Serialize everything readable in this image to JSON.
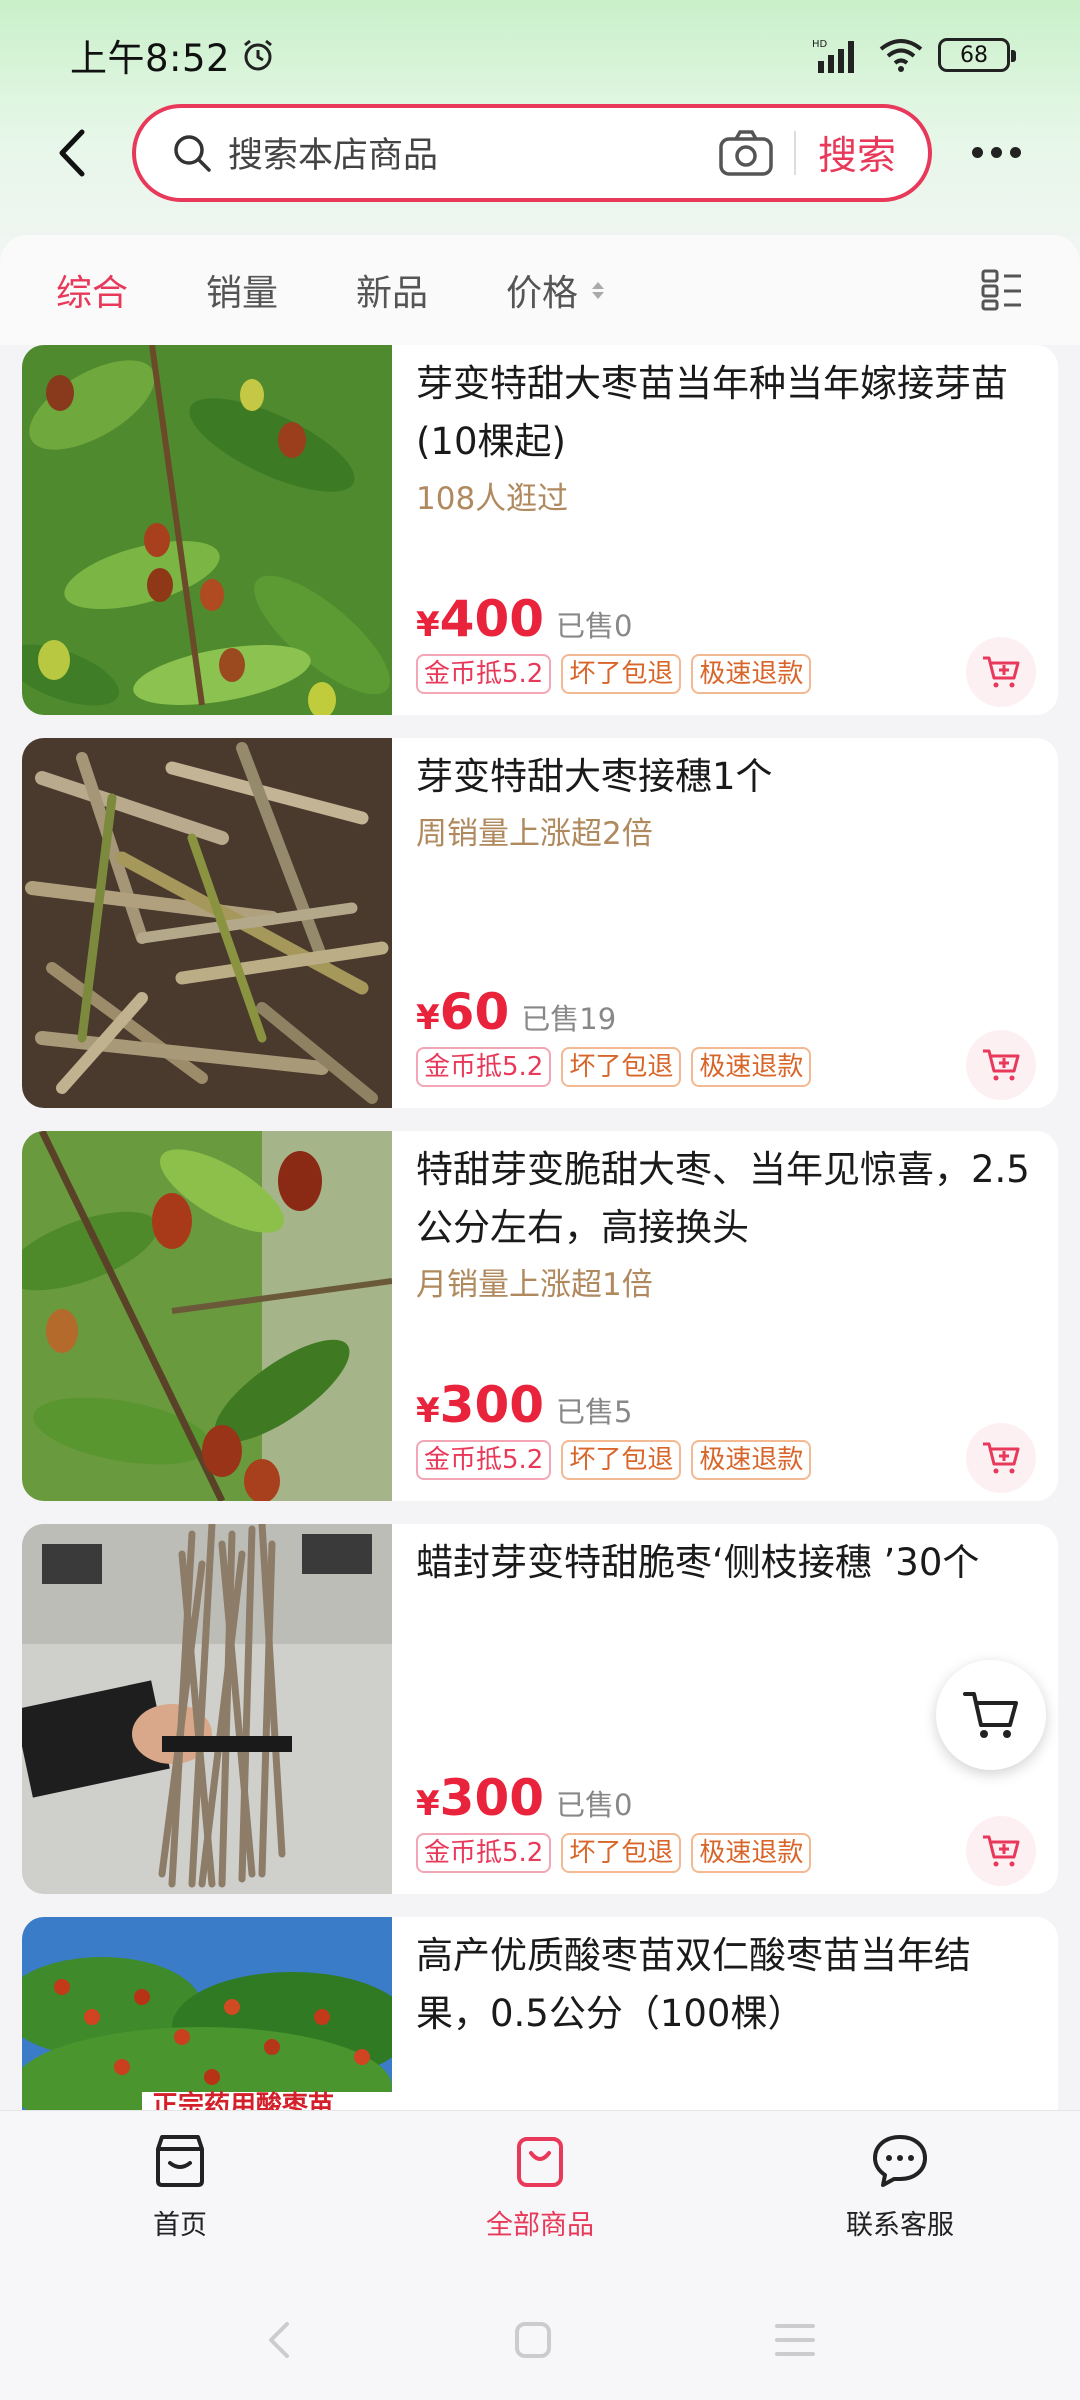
{
  "status_bar": {
    "time": "上午8:52",
    "battery": "68",
    "network": "HD"
  },
  "search": {
    "placeholder": "搜索本店商品",
    "button_label": "搜索"
  },
  "sort_tabs": [
    {
      "label": "综合",
      "active": true
    },
    {
      "label": "销量",
      "active": false
    },
    {
      "label": "新品",
      "active": false
    },
    {
      "label": "价格",
      "active": false
    }
  ],
  "products": [
    {
      "title": "芽变特甜大枣苗当年种当年嫁接芽苗(10棵起)",
      "subtitle": "108人逛过",
      "price_symbol": "¥",
      "price": "400",
      "sold": "已售0",
      "tags": [
        "金币抵5.2",
        "坏了包退",
        "极速退款"
      ]
    },
    {
      "title": "芽变特甜大枣接穗1个",
      "subtitle": "周销量上涨超2倍",
      "price_symbol": "¥",
      "price": "60",
      "sold": "已售19",
      "tags": [
        "金币抵5.2",
        "坏了包退",
        "极速退款"
      ]
    },
    {
      "title": "特甜芽变脆甜大枣、当年见惊喜，2.5公分左右，高接换头",
      "subtitle": "月销量上涨超1倍",
      "price_symbol": "¥",
      "price": "300",
      "sold": "已售5",
      "tags": [
        "金币抵5.2",
        "坏了包退",
        "极速退款"
      ]
    },
    {
      "title": "蜡封芽变特甜脆枣‘侧枝接穗 ’30个",
      "subtitle": "",
      "price_symbol": "¥",
      "price": "300",
      "sold": "已售0",
      "tags": [
        "金币抵5.2",
        "坏了包退",
        "极速退款"
      ]
    },
    {
      "title": "高产优质酸枣苗双仁酸枣苗当年结果，0.5公分（100棵）",
      "subtitle": "",
      "image_text": "正宗药用酸枣苗"
    }
  ],
  "bottom_nav": [
    {
      "label": "首页",
      "icon": "store-icon",
      "active": false
    },
    {
      "label": "全部商品",
      "icon": "shopping-bag-icon",
      "active": true
    },
    {
      "label": "联系客服",
      "icon": "chat-icon",
      "active": false
    }
  ],
  "colors": {
    "accent": "#e8395a",
    "price": "#e8233b",
    "subtitle": "#b08a5e",
    "tag_orange": "#d8662a"
  }
}
